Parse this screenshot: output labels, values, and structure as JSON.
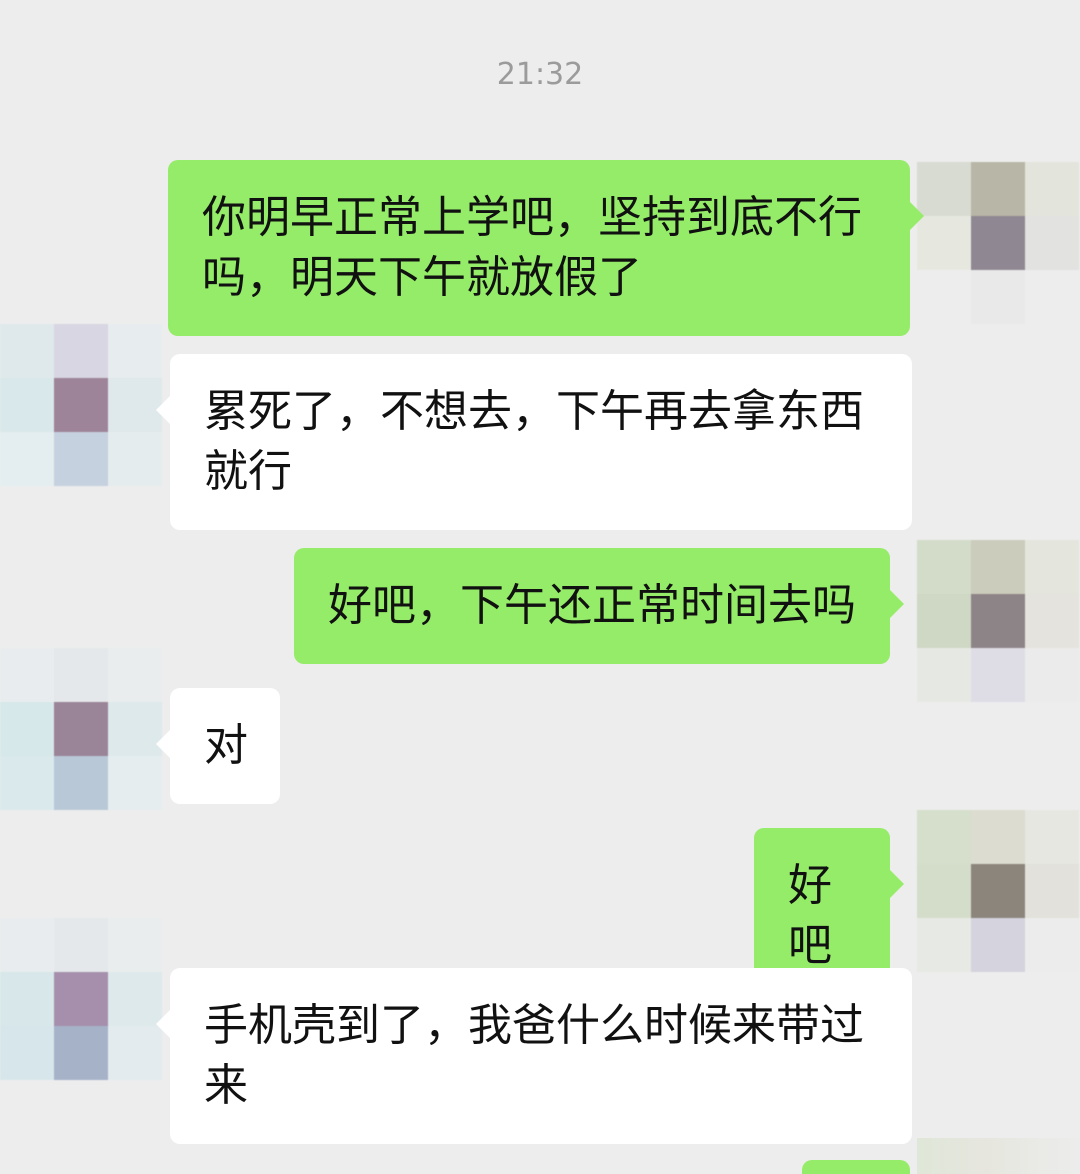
{
  "chat": {
    "timestamp": "21:32",
    "messages": [
      {
        "sender": "self",
        "text": "你明早正常上学吧，坚持到底不行吗，明天下午就放假了"
      },
      {
        "sender": "other",
        "text": "累死了，不想去，下午再去拿东西就行"
      },
      {
        "sender": "self",
        "text": "好吧，下午还正常时间去吗"
      },
      {
        "sender": "other",
        "text": "对"
      },
      {
        "sender": "self",
        "text": "好吧"
      },
      {
        "sender": "other",
        "text": "手机壳到了，我爸什么时候来带过来"
      }
    ]
  },
  "avatars": {
    "self_description": "pixelated-avatar",
    "other_description": "pixelated-avatar"
  },
  "colors": {
    "background": "#ededed",
    "outgoing_bubble": "#95ec69",
    "incoming_bubble": "#ffffff",
    "timestamp_text": "#9b9b9b"
  }
}
